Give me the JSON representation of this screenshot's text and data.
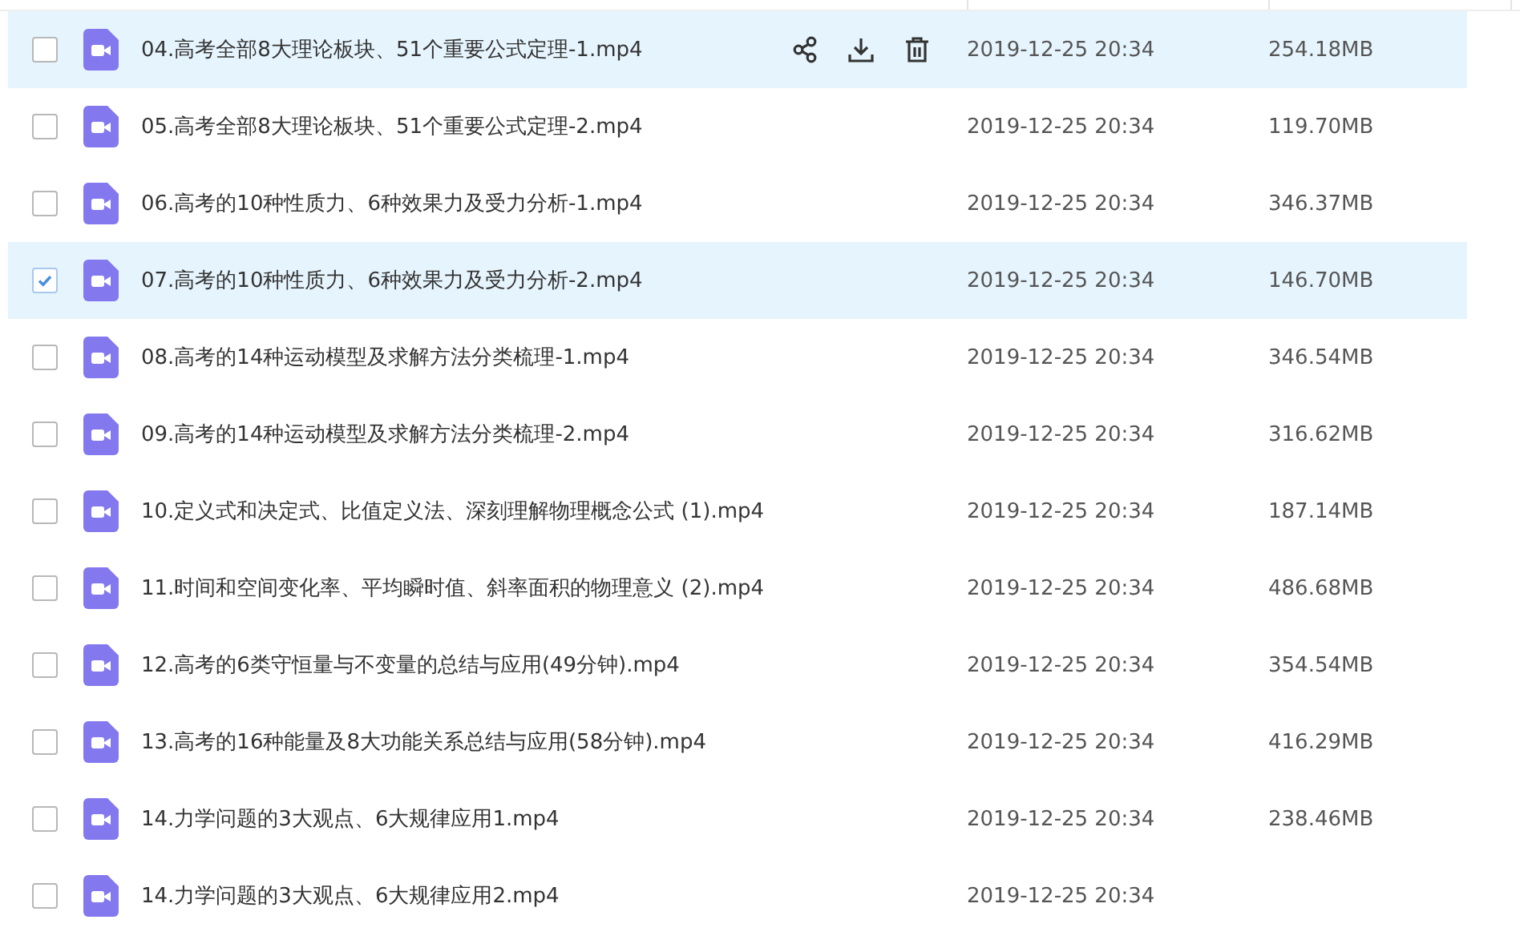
{
  "files": [
    {
      "name": "04.高考全部8大理论板块、51个重要公式定理-1.mp4",
      "modified": "2019-12-25 20:34",
      "size": "254.18MB",
      "checked": false,
      "hovered": true
    },
    {
      "name": "05.高考全部8大理论板块、51个重要公式定理-2.mp4",
      "modified": "2019-12-25 20:34",
      "size": "119.70MB",
      "checked": false,
      "hovered": false
    },
    {
      "name": "06.高考的10种性质力、6种效果力及受力分析-1.mp4",
      "modified": "2019-12-25 20:34",
      "size": "346.37MB",
      "checked": false,
      "hovered": false
    },
    {
      "name": "07.高考的10种性质力、6种效果力及受力分析-2.mp4",
      "modified": "2019-12-25 20:34",
      "size": "146.70MB",
      "checked": true,
      "hovered": false
    },
    {
      "name": "08.高考的14种运动模型及求解方法分类梳理-1.mp4",
      "modified": "2019-12-25 20:34",
      "size": "346.54MB",
      "checked": false,
      "hovered": false
    },
    {
      "name": "09.高考的14种运动模型及求解方法分类梳理-2.mp4",
      "modified": "2019-12-25 20:34",
      "size": "316.62MB",
      "checked": false,
      "hovered": false
    },
    {
      "name": "10.定义式和决定式、比值定义法、深刻理解物理概念公式 (1).mp4",
      "modified": "2019-12-25 20:34",
      "size": "187.14MB",
      "checked": false,
      "hovered": false
    },
    {
      "name": "11.时间和空间变化率、平均瞬时值、斜率面积的物理意义 (2).mp4",
      "modified": "2019-12-25 20:34",
      "size": "486.68MB",
      "checked": false,
      "hovered": false
    },
    {
      "name": "12.高考的6类守恒量与不变量的总结与应用(49分钟).mp4",
      "modified": "2019-12-25 20:34",
      "size": "354.54MB",
      "checked": false,
      "hovered": false
    },
    {
      "name": "13.高考的16种能量及8大功能关系总结与应用(58分钟).mp4",
      "modified": "2019-12-25 20:34",
      "size": "416.29MB",
      "checked": false,
      "hovered": false
    },
    {
      "name": "14.力学问题的3大观点、6大规律应用1.mp4",
      "modified": "2019-12-25 20:34",
      "size": "238.46MB",
      "checked": false,
      "hovered": false
    },
    {
      "name": "14.力学问题的3大观点、6大规律应用2.mp4",
      "modified": "2019-12-25 20:34",
      "checked": false,
      "hovered": false
    }
  ]
}
